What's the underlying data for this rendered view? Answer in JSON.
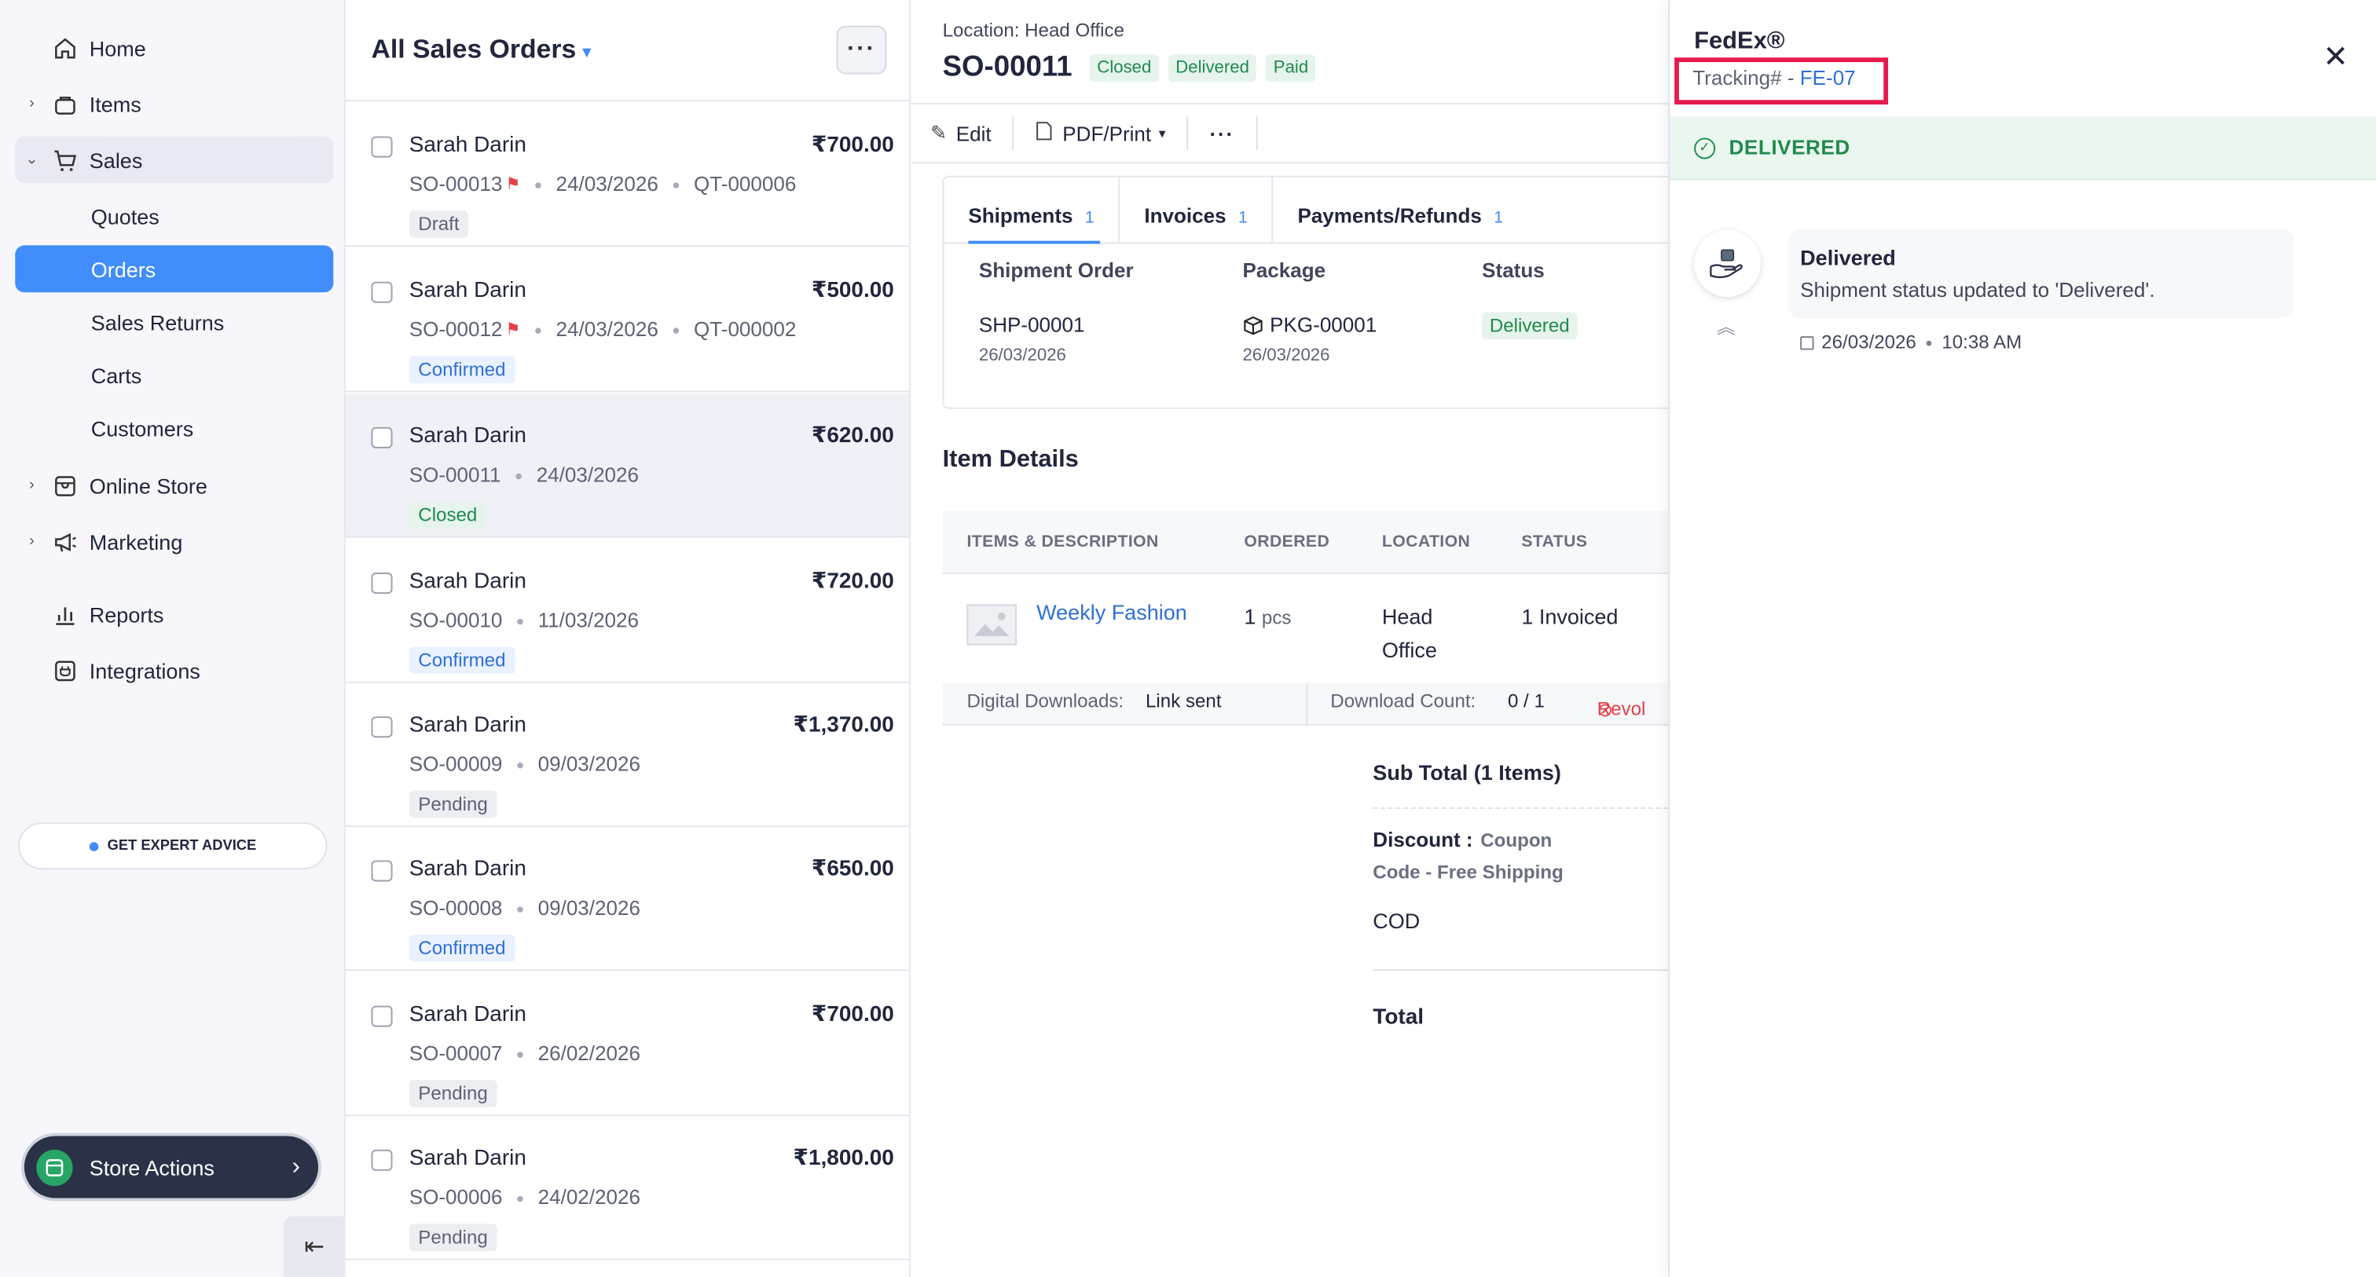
{
  "sidebar": {
    "items": [
      {
        "label": "Home",
        "icon": "home-icon"
      },
      {
        "label": "Items",
        "icon": "bag-icon"
      },
      {
        "label": "Sales",
        "icon": "cart-icon"
      },
      {
        "label": "Quotes"
      },
      {
        "label": "Orders"
      },
      {
        "label": "Sales Returns"
      },
      {
        "label": "Carts"
      },
      {
        "label": "Customers"
      },
      {
        "label": "Online Store",
        "icon": "store-icon"
      },
      {
        "label": "Marketing",
        "icon": "megaphone-icon"
      },
      {
        "label": "Reports",
        "icon": "bar-chart-icon"
      },
      {
        "label": "Integrations",
        "icon": "plug-icon"
      }
    ],
    "expert_label": "GET EXPERT ADVICE",
    "store_actions_label": "Store Actions"
  },
  "list": {
    "title": "All Sales Orders",
    "orders": [
      {
        "customer": "Sarah Darin",
        "amount": "₹700.00",
        "number": "SO-00013",
        "date": "24/03/2026",
        "quote": "QT-000006",
        "status": "Draft"
      },
      {
        "customer": "Sarah Darin",
        "amount": "₹500.00",
        "number": "SO-00012",
        "date": "24/03/2026",
        "quote": "QT-000002",
        "status": "Confirmed"
      },
      {
        "customer": "Sarah Darin",
        "amount": "₹620.00",
        "number": "SO-00011",
        "date": "24/03/2026",
        "quote": "",
        "status": "Closed"
      },
      {
        "customer": "Sarah Darin",
        "amount": "₹720.00",
        "number": "SO-00010",
        "date": "11/03/2026",
        "quote": "",
        "status": "Confirmed"
      },
      {
        "customer": "Sarah Darin",
        "amount": "₹1,370.00",
        "number": "SO-00009",
        "date": "09/03/2026",
        "quote": "",
        "status": "Pending"
      },
      {
        "customer": "Sarah Darin",
        "amount": "₹650.00",
        "number": "SO-00008",
        "date": "09/03/2026",
        "quote": "",
        "status": "Confirmed"
      },
      {
        "customer": "Sarah Darin",
        "amount": "₹700.00",
        "number": "SO-00007",
        "date": "26/02/2026",
        "quote": "",
        "status": "Pending"
      },
      {
        "customer": "Sarah Darin",
        "amount": "₹1,800.00",
        "number": "SO-00006",
        "date": "24/02/2026",
        "quote": "",
        "status": "Pending"
      }
    ]
  },
  "detail": {
    "location": "Location: Head Office",
    "order_number": "SO-00011",
    "tags": [
      "Closed",
      "Delivered",
      "Paid"
    ],
    "toolbar": {
      "edit": "Edit",
      "pdf": "PDF/Print"
    },
    "tabs": [
      {
        "label": "Shipments",
        "count": "1"
      },
      {
        "label": "Invoices",
        "count": "1"
      },
      {
        "label": "Payments/Refunds",
        "count": "1"
      }
    ],
    "shipment_headers": [
      "Shipment Order",
      "Package",
      "Status"
    ],
    "shipment": {
      "order": "SHP-00001",
      "order_date": "26/03/2026",
      "package": "PKG-00001",
      "package_date": "26/03/2026",
      "status": "Delivered"
    },
    "item_details_title": "Item Details",
    "item_headers": [
      "ITEMS & DESCRIPTION",
      "ORDERED",
      "LOCATION",
      "STATUS"
    ],
    "item": {
      "name": "Weekly Fashion",
      "ordered": "1",
      "unit": "pcs",
      "location_line1": "Head",
      "location_line2": "Office",
      "status": "1 Invoiced"
    },
    "downloads": {
      "label": "Digital Downloads:",
      "value": "Link sent",
      "count_label": "Download Count:",
      "count_value": "0 / 1",
      "revoke": "Revol"
    },
    "totals": {
      "subtotal": "Sub Total (1 Items)",
      "discount_label": "Discount :",
      "discount_detail_1": "Coupon",
      "discount_detail_2": "Code - Free Shipping",
      "cod": "COD",
      "total": "Total"
    }
  },
  "panel": {
    "carrier": "FedEx®",
    "tracking_prefix": "Tracking# - ",
    "tracking_number": "FE-07",
    "status_banner": "DELIVERED",
    "event": {
      "title": "Delivered",
      "description": "Shipment status updated to 'Delivered'.",
      "date": "26/03/2026",
      "time": "10:38 AM"
    },
    "colors": {
      "highlight": "#e8194d",
      "success": "#1f8a4c",
      "accent": "#408dfb"
    }
  }
}
